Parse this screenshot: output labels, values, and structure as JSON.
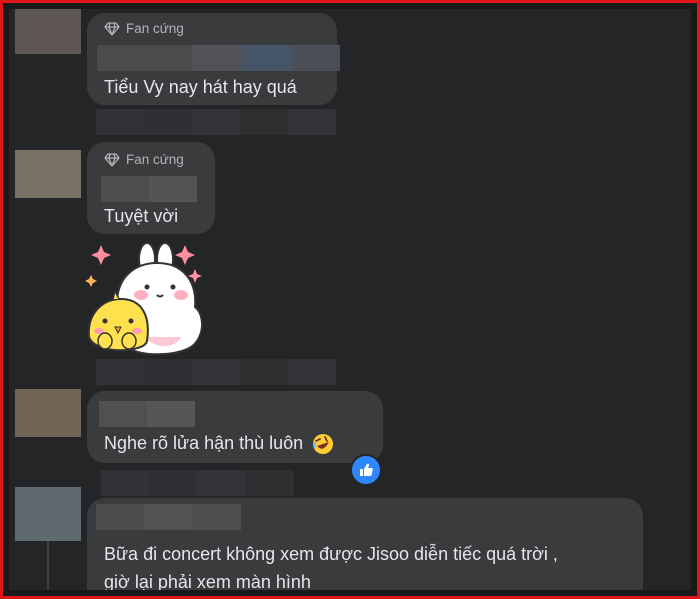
{
  "comments": [
    {
      "badge": "Fan cứng",
      "text": "Tiểu Vy nay hát hay quá"
    },
    {
      "badge": "Fan cứng",
      "text": "Tuyệt vời"
    },
    {
      "text": "Nghe rõ lửa hận thù luôn"
    },
    {
      "text_line1": "Bữa đi concert không xem được Jisoo diễn tiếc quá trời ,",
      "text_line2": "giờ lại phải xem màn hình"
    }
  ],
  "icons": {
    "badge": "diamond-icon",
    "reaction": "like-icon",
    "emoji": "rolling-on-floor-laughing-emoji",
    "sticker": "bunny-chick-sticker"
  },
  "colors": {
    "background": "#242526",
    "bubble": "#3a3b3c",
    "text": "#e4e6eb",
    "badge_text": "#b0b3b8",
    "like_blue": "#2d88ff",
    "frame": "#e0161b"
  }
}
